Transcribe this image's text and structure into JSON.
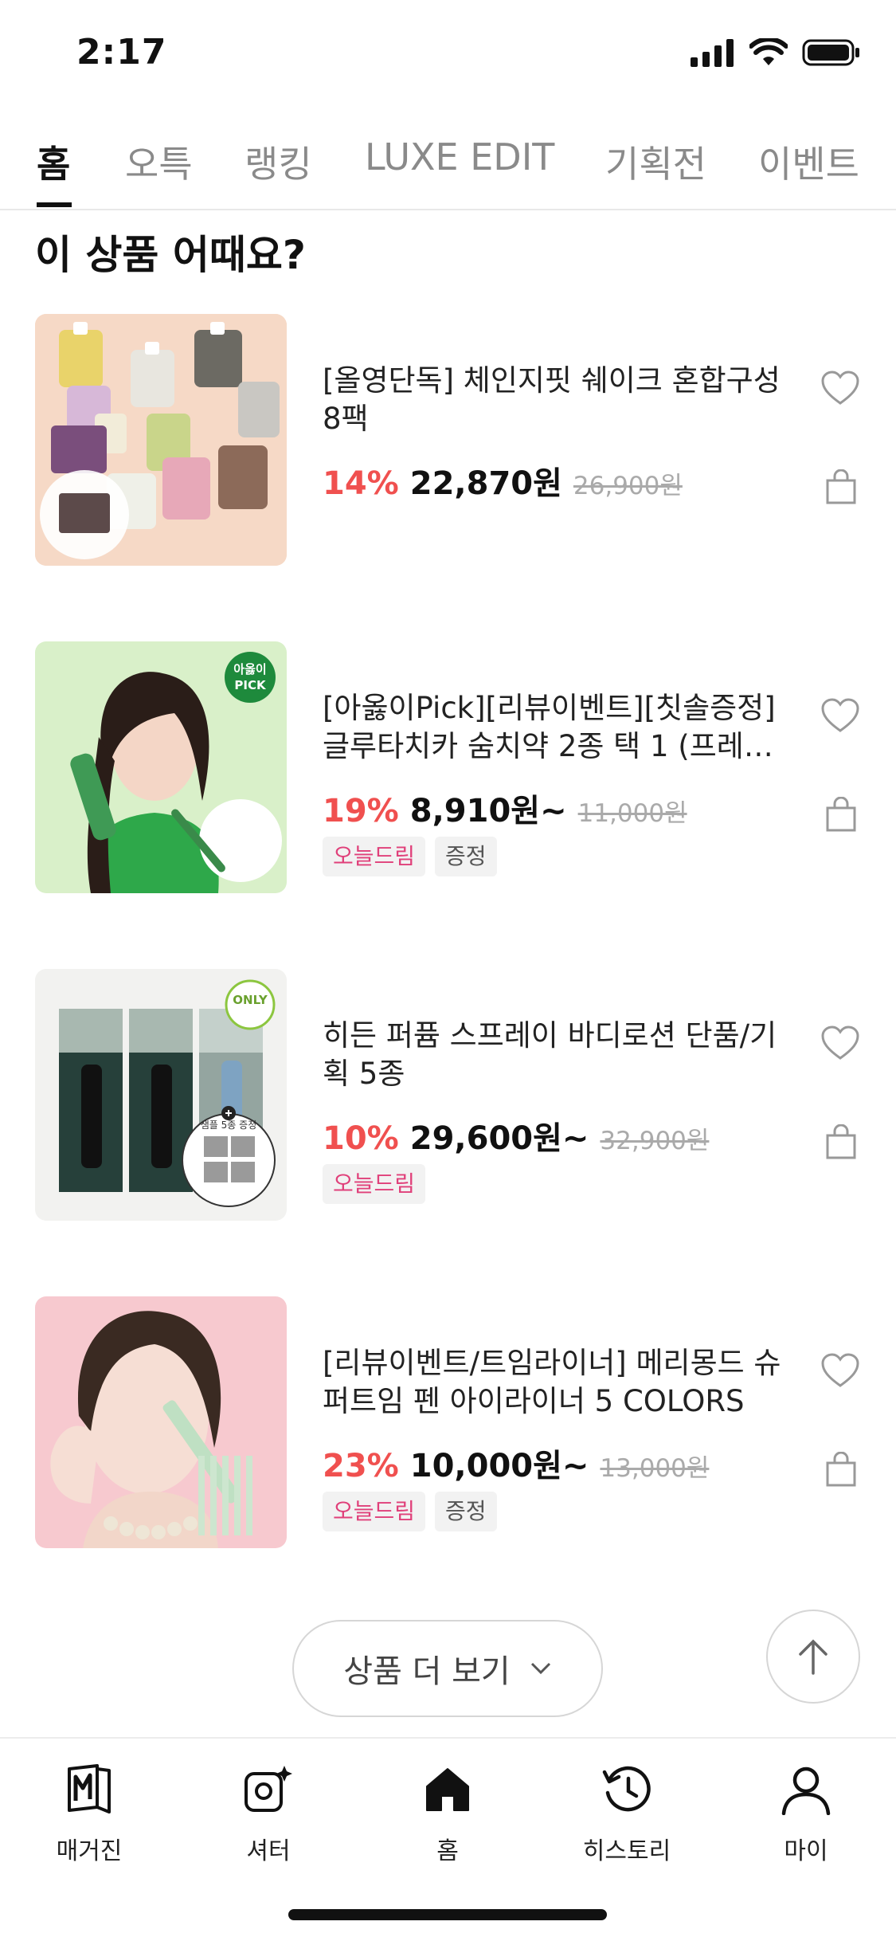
{
  "status_bar": {
    "time": "2:17"
  },
  "tabs": [
    {
      "label": "홈",
      "active": true
    },
    {
      "label": "오특"
    },
    {
      "label": "랭킹"
    },
    {
      "label": "LUXE EDIT"
    },
    {
      "label": "기획전"
    },
    {
      "label": "이벤트"
    }
  ],
  "section": {
    "title": "이 상품 어때요?"
  },
  "products": [
    {
      "name": "[올영단독] 체인지핏 쉐이크 혼합구성 8팩",
      "discount": "14%",
      "price": "22,870원",
      "original_price": "26,900원",
      "badges": [],
      "image": "shake-pouches"
    },
    {
      "name": "[아옳이Pick][리뷰이벤트][칫솔증정] 글루타치카 숨치약 2종 택 1 (프레시…",
      "discount": "19%",
      "price": "8,910원~",
      "original_price": "11,000원",
      "badges": [
        "오늘드림",
        "증정"
      ],
      "image": "toothpaste-model",
      "image_label_1": "아옳이",
      "image_label_2": "PICK"
    },
    {
      "name": "히든 퍼퓸 스프레이 바디로션 단품/기획 5종",
      "discount": "10%",
      "price": "29,600원~",
      "original_price": "32,900원",
      "badges": [
        "오늘드림"
      ],
      "image": "body-lotion-spray",
      "image_label_1": "ONLY",
      "image_label_2": "샘플 5종 증정"
    },
    {
      "name": "[리뷰이벤트/트임라이너] 메리몽드 슈퍼트임 펜 아이라이너 5 COLORS",
      "discount": "23%",
      "price": "10,000원~",
      "original_price": "13,000원",
      "badges": [
        "오늘드림",
        "증정"
      ],
      "image": "eyeliner-model"
    }
  ],
  "more_button": {
    "label": "상품 더 보기"
  },
  "bottom_nav": [
    {
      "label": "매거진",
      "icon": "magazine-icon"
    },
    {
      "label": "셔터",
      "icon": "shutter-icon"
    },
    {
      "label": "홈",
      "icon": "home-icon"
    },
    {
      "label": "히스토리",
      "icon": "history-icon"
    },
    {
      "label": "마이",
      "icon": "person-icon"
    }
  ],
  "colors": {
    "discount": "#f0504f",
    "badge_pink": "#e0407a",
    "text": "#111111"
  }
}
